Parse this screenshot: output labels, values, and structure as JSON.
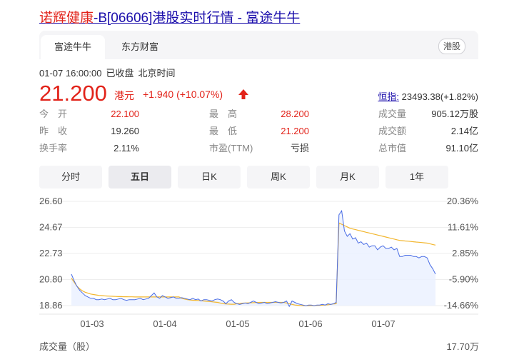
{
  "title": {
    "name": "诺辉健康",
    "rest": "-B[06606]港股实时行情 - 富途牛牛"
  },
  "tabs": [
    {
      "label": "富途牛牛"
    },
    {
      "label": "东方财富"
    }
  ],
  "market_badge": "港股",
  "meta": {
    "datetime": "01-07 16:00:00",
    "status": "已收盘",
    "tz": "北京时间"
  },
  "quote": {
    "price": "21.200",
    "unit": "港元",
    "change": "+1.940 (+10.07%)"
  },
  "index": {
    "label": "恒指:",
    "value": "23493.38(+1.82%)"
  },
  "stats": [
    [
      {
        "label": "今　开",
        "value": "22.100",
        "color": "#e2231a"
      },
      {
        "label": "最　高",
        "value": "28.200",
        "color": "#e2231a"
      },
      {
        "label": "成交量",
        "value": "905.12万股",
        "color": "#333333"
      }
    ],
    [
      {
        "label": "昨　收",
        "value": "19.260",
        "color": "#333333"
      },
      {
        "label": "最　低",
        "value": "21.200",
        "color": "#e2231a"
      },
      {
        "label": "成交额",
        "value": "2.14亿",
        "color": "#333333"
      }
    ],
    [
      {
        "label": "换手率",
        "value": "2.11%",
        "color": "#333333"
      },
      {
        "label": "市盈(TTM)",
        "value": "亏损",
        "color": "#333333"
      },
      {
        "label": "总市值",
        "value": "91.10亿",
        "color": "#333333"
      }
    ]
  ],
  "periods": [
    {
      "label": "分时"
    },
    {
      "label": "五日"
    },
    {
      "label": "日K"
    },
    {
      "label": "周K"
    },
    {
      "label": "月K"
    },
    {
      "label": "1年"
    }
  ],
  "active_period": 1,
  "volume": {
    "label": "成交量（股）",
    "max": "17.70万"
  },
  "colors": {
    "up": "#e2231a",
    "price_line": "#4a6de5",
    "avg_line": "#f2b62e",
    "area": "#eaf0ff"
  },
  "chart_data": {
    "type": "line",
    "y_ticks": [
      "26.60",
      "24.67",
      "22.73",
      "20.80",
      "18.86"
    ],
    "pct_ticks": [
      "20.36%",
      "11.61%",
      "2.85%",
      "-5.90%",
      "-14.66%"
    ],
    "ylim": [
      18.86,
      26.6
    ],
    "x_labels": [
      "01-03",
      "01-04",
      "01-05",
      "01-06",
      "01-07"
    ],
    "series": [
      {
        "values": [
          21.2,
          20.7,
          20.3,
          20.0,
          19.8,
          19.6,
          19.5,
          19.4,
          19.4,
          19.3,
          19.3,
          19.35,
          19.3,
          19.35,
          19.4,
          19.3,
          19.3,
          19.35,
          19.4,
          19.3,
          19.25,
          19.3,
          19.3,
          19.3,
          19.35,
          19.4,
          19.3,
          19.35,
          19.4,
          19.6,
          19.8,
          19.5,
          19.4,
          19.6,
          19.5,
          19.4,
          19.45,
          19.5,
          19.4,
          19.4,
          19.45,
          19.4,
          19.35,
          19.3,
          19.4,
          19.3,
          19.35,
          19.2,
          19.3,
          19.3,
          19.25,
          19.2,
          19.3,
          19.35,
          19.3,
          19.2,
          19.0,
          19.2,
          19.3,
          19.1,
          19.0,
          18.95,
          19.0,
          19.05,
          19.0,
          19.1,
          19.2,
          19.1,
          19.0,
          19.05,
          19.1,
          19.0,
          19.05,
          19.1,
          19.15,
          19.1,
          19.05,
          19.1,
          19.2,
          18.8,
          19.2,
          19.1,
          19.0,
          18.95,
          18.9,
          18.85,
          18.9,
          18.9,
          18.85,
          18.9,
          18.9,
          18.95,
          18.9,
          19.0,
          18.95,
          19.0,
          19.1,
          25.6,
          25.9,
          24.4,
          24.0,
          24.2,
          23.8,
          23.9,
          23.5,
          23.6,
          23.4,
          23.5,
          23.2,
          23.3,
          23.3,
          23.0,
          23.2,
          23.3,
          23.1,
          23.1,
          23.2,
          23.0,
          23.1,
          22.5,
          22.5,
          22.6,
          22.6,
          22.6,
          22.5,
          22.5,
          22.4,
          22.5,
          22.5,
          22.4,
          21.9,
          21.6,
          21.2
        ]
      },
      {
        "values": [
          20.9,
          20.6,
          20.3,
          20.1,
          19.95,
          19.85,
          19.78,
          19.72,
          19.68,
          19.65,
          19.62,
          19.6,
          19.58,
          19.57,
          19.56,
          19.55,
          19.54,
          19.53,
          19.53,
          19.52,
          19.52,
          19.51,
          19.51,
          19.5,
          19.5,
          19.5,
          19.5,
          19.5,
          19.5,
          19.5,
          19.5,
          19.5,
          19.5,
          19.5,
          19.5,
          19.5,
          19.5,
          19.5,
          19.5,
          19.5,
          19.4,
          19.35,
          19.3,
          19.28,
          19.26,
          19.25,
          19.24,
          19.22,
          19.2,
          19.18,
          19.16,
          19.14,
          19.12,
          19.1,
          19.05,
          19.0,
          18.98,
          18.97,
          18.96,
          18.96,
          19.0,
          19.02,
          19.04,
          19.05,
          19.06,
          19.07,
          19.08,
          19.09,
          19.1,
          19.1,
          19.1,
          19.1,
          19.1,
          19.1,
          19.1,
          19.1,
          19.1,
          19.1,
          19.05,
          19.0,
          18.95,
          18.9,
          18.88,
          18.86,
          18.85,
          18.85,
          18.85,
          18.86,
          18.86,
          18.87,
          18.88,
          18.89,
          18.9,
          18.92,
          18.95,
          18.98,
          19.0,
          25.0,
          24.9,
          24.8,
          24.7,
          24.6,
          24.55,
          24.5,
          24.45,
          24.4,
          24.35,
          24.3,
          24.25,
          24.2,
          24.15,
          24.1,
          24.05,
          24.0,
          23.95,
          23.9,
          23.85,
          23.8,
          23.75,
          23.7,
          23.68,
          23.66,
          23.64,
          23.62,
          23.6,
          23.58,
          23.56,
          23.54,
          23.52,
          23.5,
          23.45,
          23.4,
          23.35
        ]
      }
    ]
  }
}
